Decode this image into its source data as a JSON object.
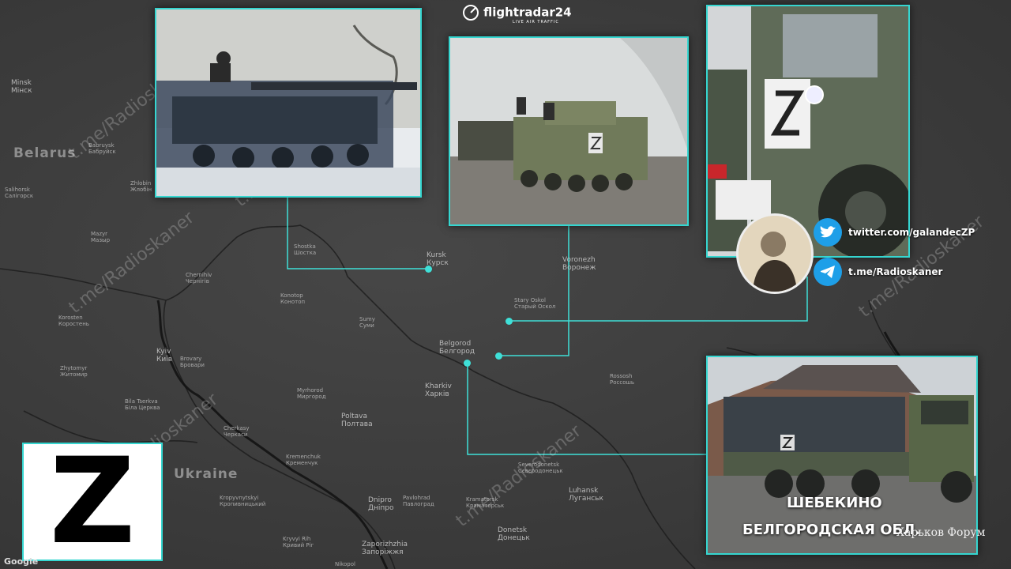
{
  "logo": {
    "name": "flightradar24",
    "sub": "LIVE AIR TRAFFIC"
  },
  "watermark": "t.me/Radioskaner",
  "countries": {
    "belarus": "Belarus",
    "ukraine": "Ukraine"
  },
  "cities": {
    "minsk": "Minsk\nМінск",
    "babruysk": "Babruysk\nБабруйск",
    "salihorsk": "Salihorsk\nСалігорск",
    "zhlobin": "Zhlobin\nЖлобін",
    "mazyr": "Mazyr\nМазыр",
    "chernihiv": "Chernihiv\nЧернігів",
    "shostka": "Shostka\nШостка",
    "kursk": "Kursk\nКурск",
    "voronezh": "Voronezh\nВоронеж",
    "konotop": "Konotop\nКонотоп",
    "sumy": "Sumy\nСуми",
    "stary_oskol": "Stary Oskol\nСтарый Оскол",
    "belgorod": "Belgorod\nБелгород",
    "kyiv": "Kyiv\nКиїв",
    "brovary": "Brovary\nБровари",
    "kharkiv": "Kharkiv\nХарків",
    "poltava": "Poltava\nПолтава",
    "zhytomyr": "Zhytomyr\nЖитомир",
    "bila_tserkva": "Bila Tserkva\nБіла Церква",
    "cherkasy": "Cherkasy\nЧеркаси",
    "kremenchuk": "Kremenchuk\nКременчук",
    "kropyvnytskyi": "Kropyvnytskyi\nКропивницький",
    "dnipro": "Dnipro\nДніпро",
    "pavlohrad": "Pavlohrad\nПавлоград",
    "kryvyi_rih": "Kryvyi Rih\nКривий Ріг",
    "zaporizhzhia": "Zaporizhzhia\nЗапоріжжя",
    "luhansk": "Luhansk\nЛуганськ",
    "donetsk": "Donetsk\nДонецьк",
    "rossosh": "Rossosh\nРоссошь",
    "korosten": "Korosten\nКоростень",
    "mirhorod": "Myrhorod\nМиргород",
    "severodonetsk": "Severodonetsk\nСєвєродонецьк",
    "kramatorsk": "Kramatorsk\nКраматорськ",
    "nikopol": "Nikopol"
  },
  "social": {
    "twitter": "twitter.com/galandecZP",
    "telegram": "t.me/Radioskaner"
  },
  "big_letter": "Z",
  "caption": {
    "line1": "ШЕБЕКИНО",
    "line2": "БЕЛГОРОДСКАЯ ОБЛ."
  },
  "forum": "Харьков Форум",
  "google": "Google",
  "colors": {
    "accent": "#35d6d0",
    "twitter": "#1e9fe8",
    "map_bg": "#3c3c3c"
  }
}
